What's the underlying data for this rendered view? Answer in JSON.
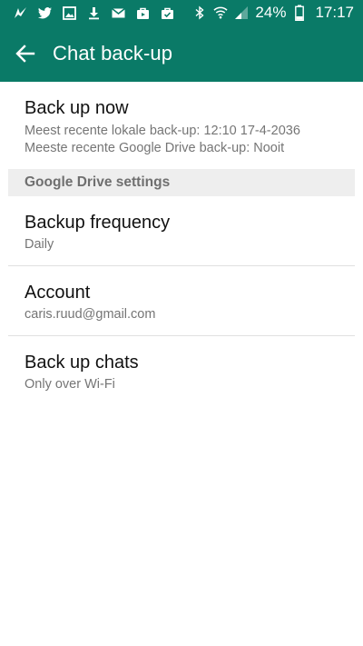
{
  "status_bar": {
    "left_icons": [
      "whatsapp-icon",
      "twitter-icon",
      "image-icon",
      "download-icon",
      "mail-icon",
      "bag-icon",
      "check-bag-icon"
    ],
    "right_icons": [
      "bluetooth-icon",
      "wifi-icon",
      "signal-icon"
    ],
    "battery": "24%",
    "time": "17:17"
  },
  "app_bar": {
    "title": "Chat back-up",
    "color": "#0a7a67"
  },
  "backup_now": {
    "title": "Back up now",
    "last_local": "Meest recente lokale back-up: 12:10 17-4-2036",
    "last_drive": "Meeste recente Google Drive back-up: Nooit"
  },
  "drive_settings": {
    "header": "Google Drive settings",
    "items": [
      {
        "title": "Backup frequency",
        "value": "Daily"
      },
      {
        "title": "Account",
        "value": "caris.ruud@gmail.com"
      },
      {
        "title": "Back up chats",
        "value": "Only over Wi-Fi"
      }
    ]
  }
}
